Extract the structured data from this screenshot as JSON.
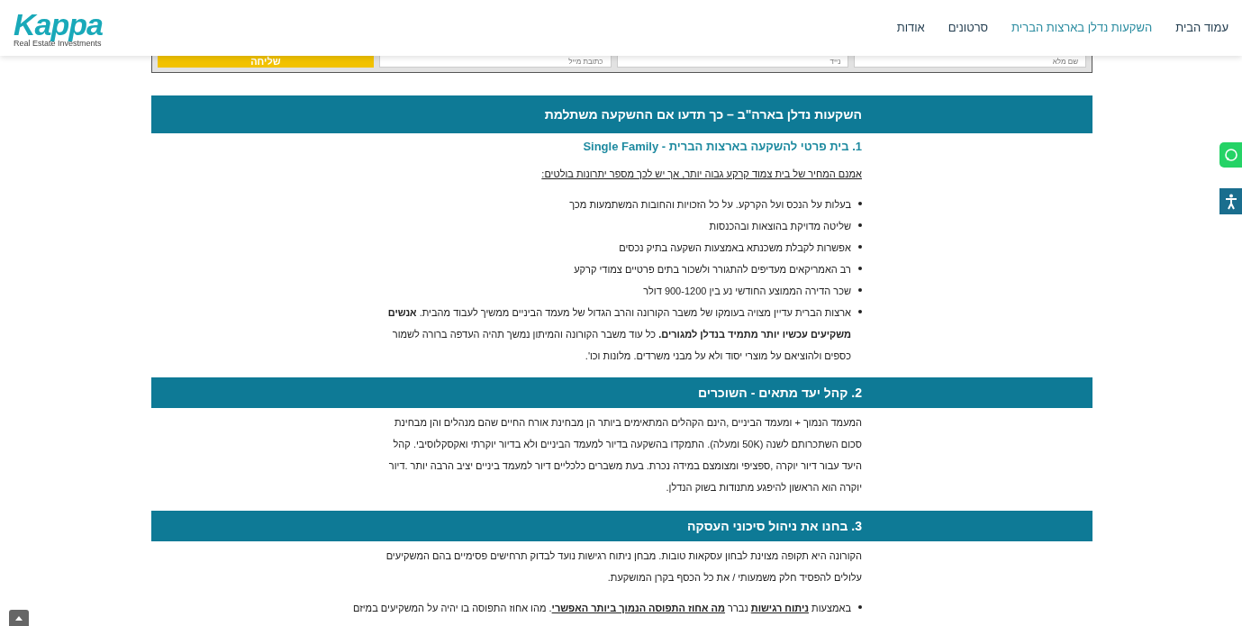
{
  "logo": {
    "name": "Kappa",
    "tagline": "Real Estate Investments"
  },
  "nav": [
    {
      "label": "עמוד הבית",
      "selected": false
    },
    {
      "label": "השקעות נדלן בארצות הברית",
      "selected": true
    },
    {
      "label": "סרטונים",
      "selected": false
    },
    {
      "label": "אודות",
      "selected": false
    }
  ],
  "form": {
    "fields": [
      {
        "placeholder": "שם מלא"
      },
      {
        "placeholder": "נייד"
      },
      {
        "placeholder": "כתובת מייל"
      }
    ],
    "submit": "שליחה"
  },
  "title": "השקעות נדלן בארה\"ב – כך תדעו אם ההשקעה משתלמת",
  "sections": [
    {
      "kind": "subheading",
      "heading": "1. בית פרטי להשקעה בארצות הברית - Single Family",
      "intro": "אמנם המחיר של בית צמוד קרקע גבוה יותר, אך יש לכך מספר יתרונות בולטים:",
      "bullets": [
        "בעלות על הנכס ועל הקרקע. על כל הזכויות והחובות המשתמעות מכך",
        "שליטה מדויקת בהוצאות ובהכנסות",
        "אפשרות לקבלת משכנתא באמצעות השקעה בתיק נכסים",
        "רב האמריקאים מעדיפים להתגורר ולשכור בתים פרטיים צמודי קרקע",
        "שכר הדירה הממוצע החודשי נע בין  900-1200 דולר",
        "ארצות הברית עדיין מצויה בעומקו של משבר הקורונה והרב הגדול של מעמד הביניים ממשיך לעבוד מהבית. **אנשים משקיעים עכשיו יותר מתמיד בנדלן למגורים.** כל עוד משבר הקורונה והמיתון נמשך תהיה העדפה ברורה לשמור כספים ולהוציאם על מוצרי יסוד ולא על מבני משרדים. מלונות וכו'."
      ]
    },
    {
      "kind": "bar",
      "heading": "2. קהל יעד מתאים - השוכרים",
      "paragraphs": [
        "המעמד הנמוך + ומעמד הביניים ,הינם הקהלים המתאימים ביותר הן מבחינת אורח החיים שהם מנהלים והן מבחינת סכום השתכרותם לשנה (50K ומעלה). התמקדו בהשקעה בדיור למעמד הביניים ולא בדיור יוקרתי ואקסקלוסיבי. קהל היעד עבור דיור יוקרה ,ספציפי ומצומצם במידה נכרת. בעת משברים כלכליים דיור למעמד ביניים יציב הרבה יותר .דיור יוקרה הוא הראשון להיפגע מתנודות בשוק הנדלן."
      ]
    },
    {
      "kind": "bar",
      "heading": "3. בחנו את ניהול סיכוני העסקה",
      "paragraphs": [
        "הקורונה היא תקופה מצוינת לבחון עסקאות טובות. מבחן ניתוח רגישות נועד לבדוק תרחישים פסימיים בהם המשקיעים עלולים להפסיד חלק משמעותי / את כל הכסף בקרן המושקעת."
      ],
      "underlined_bullets": [
        "באמצעות **ניתוח רגישות** נברר **מה אחוז התפוסה הנמוך ביותר האפשרי**. מהו אחוז התפוסה בו יהיה על המשקיעים במיזם"
      ]
    }
  ]
}
